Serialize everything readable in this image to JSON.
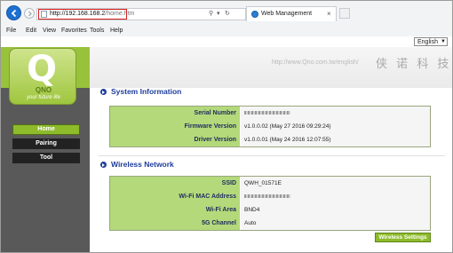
{
  "browser": {
    "url_host": "http://192.168.168.2",
    "url_path": "/home.htm",
    "address_tools": {
      "search": "⚲",
      "dropdown": "▾",
      "refresh": "↻"
    },
    "tab_title": "Web Management",
    "tab_close": "×",
    "menu": [
      "File",
      "Edit",
      "View",
      "Favorites",
      "Tools",
      "Help"
    ]
  },
  "header": {
    "language": "English",
    "site_url": "http://www.Qno.com.tw/english/",
    "slogan": "侠 诺 科 技"
  },
  "logo": {
    "mark": "Q",
    "word": "QNO",
    "tagline": "your future life"
  },
  "sidebar": {
    "items": [
      {
        "label": "Home",
        "active": true
      },
      {
        "label": "Pairing",
        "active": false
      },
      {
        "label": "Tool",
        "active": false
      }
    ]
  },
  "system_information": {
    "title": "System Information",
    "rows": [
      {
        "label": "Serial Number",
        "value": ""
      },
      {
        "label": "Firmware Version",
        "value": "v1.0.0.02 (May 27 2016 09:29:24)"
      },
      {
        "label": "Driver Version",
        "value": "v1.0.0.01 (May 24 2016 12:07:55)"
      }
    ]
  },
  "wireless_network": {
    "title": "Wireless Network",
    "rows": [
      {
        "label": "SSID",
        "value": "QWH_01571E"
      },
      {
        "label": "Wi-Fi MAC Address",
        "value": ""
      },
      {
        "label": "Wi-Fi Area",
        "value": "BND4"
      },
      {
        "label": "5G Channel",
        "value": "Auto"
      }
    ],
    "button_label": "Wireless Settings"
  },
  "colors": {
    "accent_green": "#8dbb2a",
    "label_green": "#b3d97a",
    "heading_blue": "#1f3d9c",
    "highlight_red": "#d31f1f"
  }
}
